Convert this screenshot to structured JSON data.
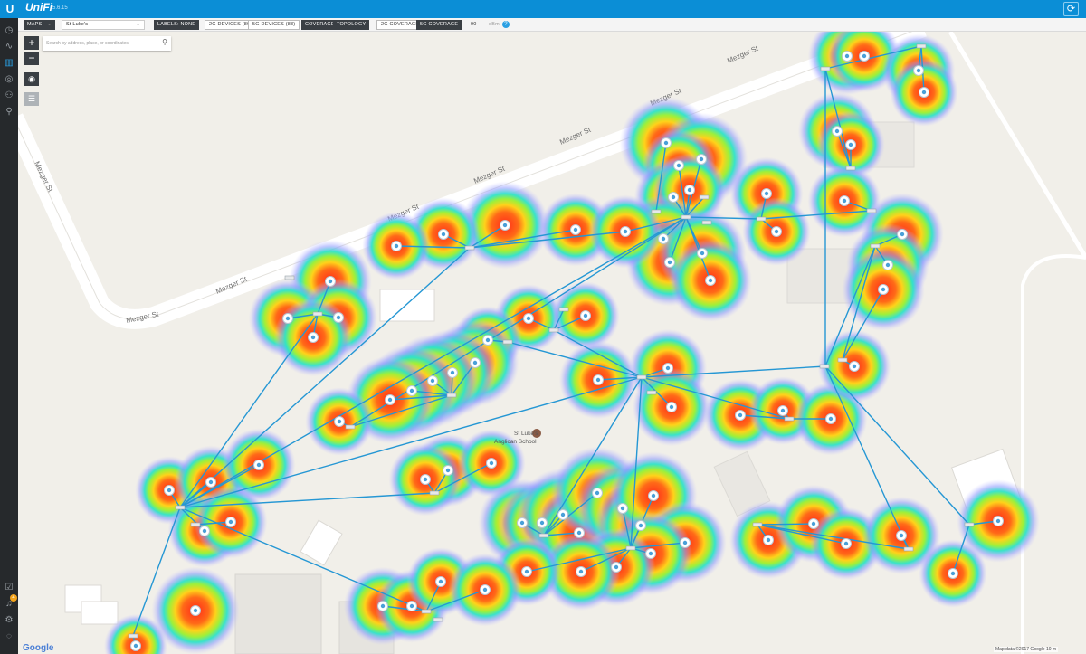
{
  "header": {
    "logo": "U",
    "brand": "UniFi",
    "version": "5.6.15",
    "refresh_icon": "refresh-icon"
  },
  "sidenav": {
    "items": [
      {
        "icon": "dashboard-icon",
        "glyph": "◷"
      },
      {
        "icon": "statistics-icon",
        "glyph": "∿"
      },
      {
        "icon": "map-icon",
        "glyph": "▥"
      },
      {
        "icon": "devices-icon",
        "glyph": "◎"
      },
      {
        "icon": "clients-icon",
        "glyph": "⚇"
      },
      {
        "icon": "insights-icon",
        "glyph": "⚲"
      }
    ],
    "bottom_items": [
      {
        "icon": "tasks-icon",
        "glyph": "☑"
      },
      {
        "icon": "alerts-icon",
        "glyph": "♫"
      },
      {
        "icon": "settings-icon",
        "glyph": "⚙"
      },
      {
        "icon": "chat-icon",
        "glyph": "◌"
      }
    ],
    "alerts_badge": "4"
  },
  "toolbar": {
    "maps": "MAPS",
    "site": "St Luke's",
    "labels": "LABELS: NONE",
    "devices_2g": "2G DEVICES (86)",
    "devices_5g": "5G DEVICES (83)",
    "coverage": "COVERAGE",
    "topology": "TOPOLOGY",
    "coverage_2g": "2G COVERAGE",
    "coverage_5g": "5G COVERAGE",
    "signal": "-90",
    "unit": "dBm",
    "help": "?"
  },
  "map_controls": {
    "zoom_in": "+",
    "zoom_out": "−",
    "locate": "◉",
    "list": "☰",
    "search_placeholder": "Search by address, place, or coordinates",
    "search_icon": "search-icon"
  },
  "streets": [
    "Mezger St",
    "Mezger St",
    "Mezger St",
    "Mezger St",
    "Mezger St",
    "Mezger St",
    "Mezger St",
    "Mezger St"
  ],
  "poi": {
    "line1": "St Luke's",
    "line2": "Anglican School"
  },
  "footer": {
    "google": "Google",
    "attribution": "Map data ©2017 Google   10 m"
  },
  "colors": {
    "accent": "#0b8ed6",
    "link": "#2597d4",
    "nav": "#26292c",
    "toolbar_dark": "#3a3f44",
    "map_bg": "#f1efe9"
  }
}
